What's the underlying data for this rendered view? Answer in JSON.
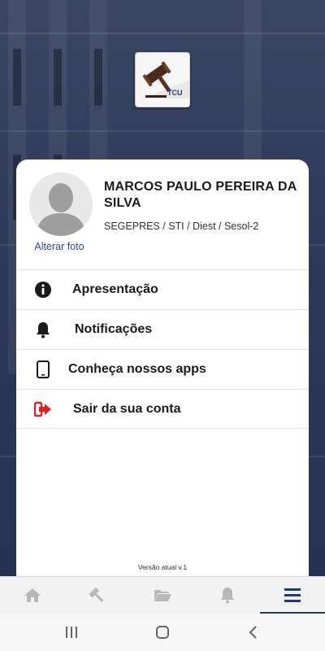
{
  "app": {
    "logo_text": "TCU",
    "logo_name": "gavel-logo"
  },
  "profile": {
    "name": "MARCOS PAULO PEREIRA DA SILVA",
    "organization": "SEGEPRES / STI / Diest / Sesol-2",
    "change_photo_label": "Alterar foto"
  },
  "menu": {
    "items": [
      {
        "label": "Apresentação",
        "icon": "info-icon"
      },
      {
        "label": "Notificações",
        "icon": "bell-icon"
      },
      {
        "label": "Conheça nossos apps",
        "icon": "tablet-icon"
      },
      {
        "label": "Sair da sua conta",
        "icon": "logout-icon",
        "icon_color": "#e02020"
      }
    ]
  },
  "footer": {
    "version": "Versão atual v.1"
  },
  "tabbar": {
    "tabs": [
      {
        "icon": "home-icon",
        "active": false
      },
      {
        "icon": "gavel-icon",
        "active": false
      },
      {
        "icon": "folder-open-icon",
        "active": false
      },
      {
        "icon": "bell-icon",
        "active": false
      },
      {
        "icon": "menu-icon",
        "active": true
      }
    ],
    "active_color": "#1f3b74",
    "inactive_color": "#b8b8b8"
  },
  "system_nav": {
    "buttons": [
      "recents-icon",
      "home-circle-icon",
      "back-icon"
    ]
  }
}
